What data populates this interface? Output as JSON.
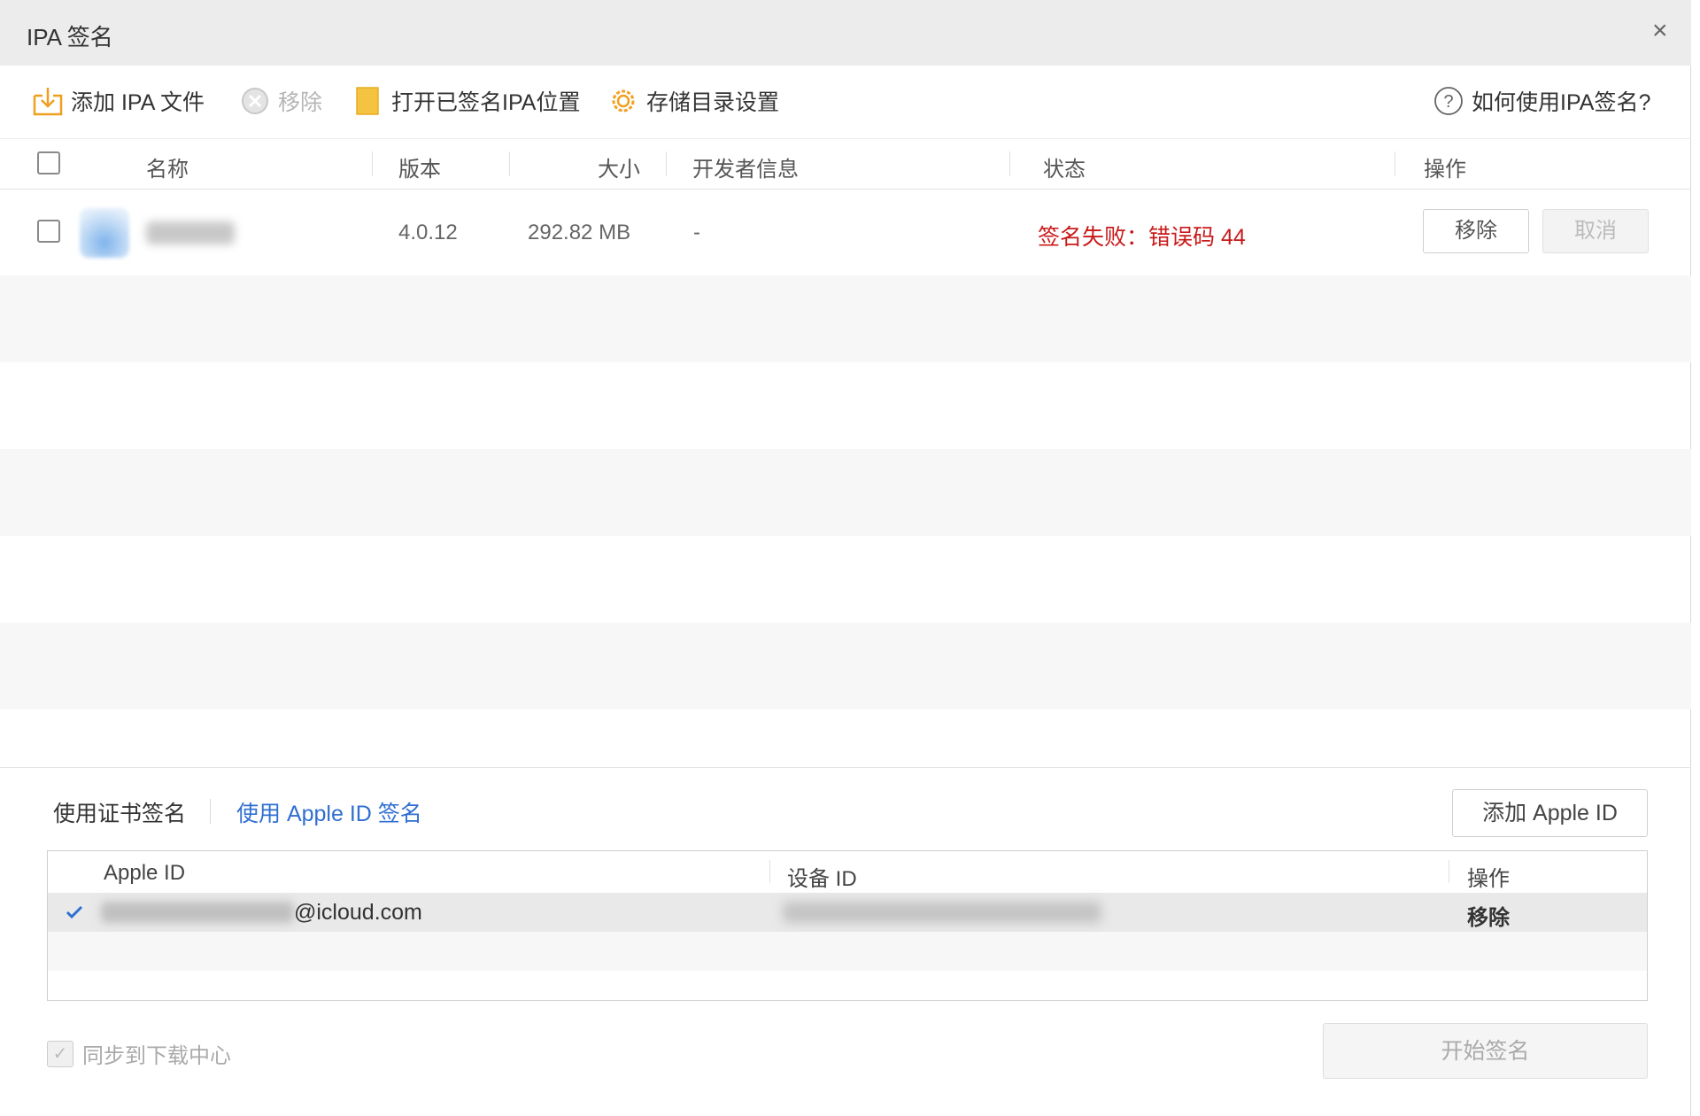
{
  "window": {
    "title": "IPA 签名",
    "close_icon": "×"
  },
  "toolbar": {
    "add_ipa": "添加 IPA 文件",
    "remove": "移除",
    "open_signed": "打开已签名IPA位置",
    "storage_settings": "存储目录设置",
    "help": "如何使用IPA签名?"
  },
  "table": {
    "headers": {
      "name": "名称",
      "version": "版本",
      "size": "大小",
      "developer": "开发者信息",
      "status": "状态",
      "actions": "操作"
    },
    "rows": [
      {
        "version": "4.0.12",
        "size": "292.82 MB",
        "developer": "-",
        "status": "签名失败：错误码 44",
        "remove": "移除",
        "cancel": "取消"
      }
    ]
  },
  "sign_tabs": {
    "cert": "使用证书签名",
    "apple_id": "使用 Apple ID 签名"
  },
  "add_apple_id": "添加 Apple ID",
  "apple_id_table": {
    "headers": {
      "apple_id": "Apple ID",
      "device_id": "设备 ID",
      "actions": "操作"
    },
    "rows": [
      {
        "email_suffix": "@icloud.com",
        "action": "移除",
        "selected": true
      }
    ]
  },
  "sync_label": "同步到下载中心",
  "start_sign": "开始签名",
  "colors": {
    "error": "#c81a1a",
    "link": "#2f6fd1",
    "folder": "#f5c342"
  }
}
